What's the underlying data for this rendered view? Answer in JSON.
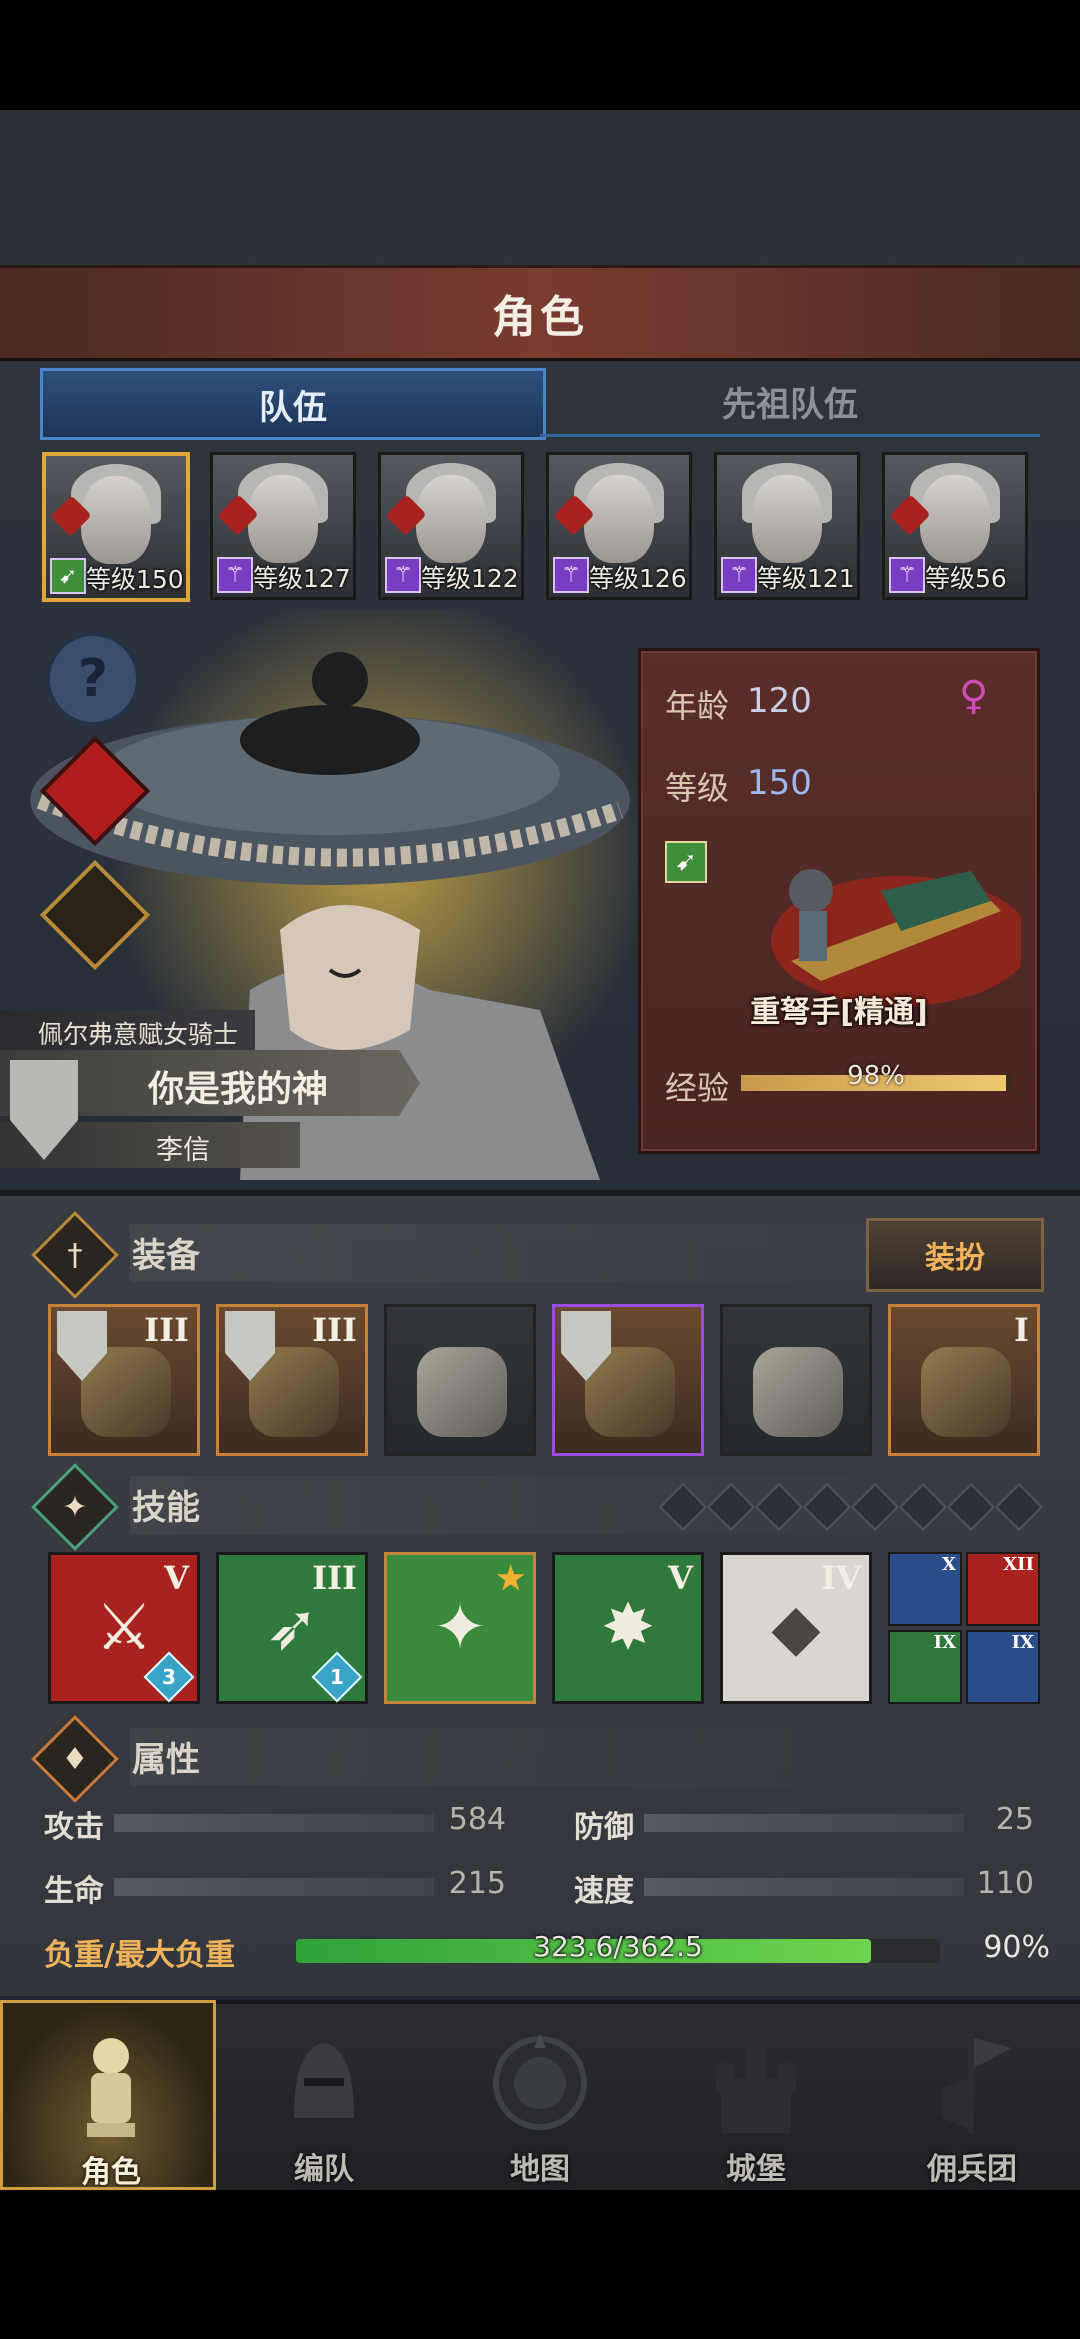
{
  "header": {
    "title": "角色"
  },
  "tabs": [
    {
      "label": "队伍",
      "active": true
    },
    {
      "label": "先祖队伍",
      "active": false
    }
  ],
  "party": [
    {
      "level_label": "等级150",
      "class_icon": "crossbow-icon",
      "class_color": "#3f8e3a",
      "selected": true,
      "bloodline_icon": "bloodline-icon"
    },
    {
      "level_label": "等级127",
      "class_icon": "staff-icon",
      "class_color": "#7a3cc0",
      "selected": false,
      "bloodline_icon": "bloodline-icon"
    },
    {
      "level_label": "等级122",
      "class_icon": "staff-icon",
      "class_color": "#7a3cc0",
      "selected": false,
      "bloodline_icon": "bloodline-icon"
    },
    {
      "level_label": "等级126",
      "class_icon": "staff-icon",
      "class_color": "#7a3cc0",
      "selected": false,
      "bloodline_icon": "bloodline-icon"
    },
    {
      "level_label": "等级121",
      "class_icon": "staff-icon",
      "class_color": "#7a3cc0",
      "selected": false,
      "bloodline_icon": ""
    },
    {
      "level_label": "等级56",
      "class_icon": "staff-icon",
      "class_color": "#7a3cc0",
      "selected": false,
      "bloodline_icon": "bloodline-icon"
    }
  ],
  "hero": {
    "faction_title": "佩尔弗意赋女骑士",
    "epithet": "你是我的神",
    "name": "李信",
    "age_label": "年龄",
    "age": "120",
    "level_label": "等级",
    "level": "150",
    "gender_icon": "female-icon",
    "class_name": "重弩手[精通]",
    "exp_label": "经验",
    "exp_percent_text": "98%",
    "exp_fraction": 0.98
  },
  "equipment": {
    "section_label": "装备",
    "dress_button": "装扮",
    "slots": [
      {
        "name": "weapon-slot-1",
        "rank": "III",
        "has_shield": true,
        "rarity_color": "#c9823a"
      },
      {
        "name": "weapon-slot-2",
        "rank": "III",
        "has_shield": true,
        "rarity_color": "#c9823a"
      },
      {
        "name": "helmet-slot",
        "rank": "",
        "has_shield": false,
        "rarity_color": "#222222"
      },
      {
        "name": "armor-slot",
        "rank": "",
        "has_shield": true,
        "rarity_color": "#9b4de0"
      },
      {
        "name": "boots-slot",
        "rank": "",
        "has_shield": false,
        "rarity_color": "#222222"
      },
      {
        "name": "book-slot",
        "rank": "I",
        "has_shield": false,
        "rarity_color": "#c9823a"
      }
    ]
  },
  "skills": {
    "section_label": "技能",
    "empty_slots": 8,
    "items": [
      {
        "rank": "V",
        "badge": "3",
        "bg": "#a8231f",
        "glyph": "⚔"
      },
      {
        "rank": "III",
        "badge": "1",
        "bg": "#2f7a3a",
        "glyph": "➶"
      },
      {
        "rank": "",
        "badge": "",
        "bg": "#3a8a3c",
        "glyph": "✦",
        "starred": true
      },
      {
        "rank": "V",
        "badge": "",
        "bg": "#2f7a3a",
        "glyph": "✸"
      },
      {
        "rank": "IV",
        "badge": "",
        "bg": "#d8d6cf",
        "glyph": "◆"
      }
    ],
    "mini": [
      {
        "rank": "X",
        "bg": "#2c4e8a"
      },
      {
        "rank": "XII",
        "bg": "#a8231f"
      },
      {
        "rank": "IX",
        "bg": "#2f7a3a"
      },
      {
        "rank": "IX",
        "bg": "#2c4e8a"
      }
    ]
  },
  "attributes": {
    "section_label": "属性",
    "stats": [
      {
        "label": "攻击",
        "value": "584"
      },
      {
        "label": "防御",
        "value": "25"
      },
      {
        "label": "生命",
        "value": "215"
      },
      {
        "label": "速度",
        "value": "110"
      }
    ],
    "weight_label": "负重/最大负重",
    "weight_text": "323.6/362.5",
    "weight_percent": "90%",
    "weight_fraction": 0.8927
  },
  "nav": [
    {
      "label": "角色",
      "icon": "knight-icon",
      "active": true
    },
    {
      "label": "编队",
      "icon": "helmet-icon",
      "active": false
    },
    {
      "label": "地图",
      "icon": "compass-map-icon",
      "active": false
    },
    {
      "label": "城堡",
      "icon": "castle-icon",
      "active": false
    },
    {
      "label": "佣兵团",
      "icon": "banner-icon",
      "active": false
    }
  ],
  "side_buttons": [
    {
      "icon": "help-icon",
      "glyph": "?"
    },
    {
      "icon": "bloodline-icon",
      "glyph": ""
    },
    {
      "icon": "potion-icon",
      "glyph": ""
    }
  ],
  "colors": {
    "accent_gold": "#d29d3e",
    "tab_blue": "#4d86c8",
    "weight_green": "#2fa23a"
  }
}
